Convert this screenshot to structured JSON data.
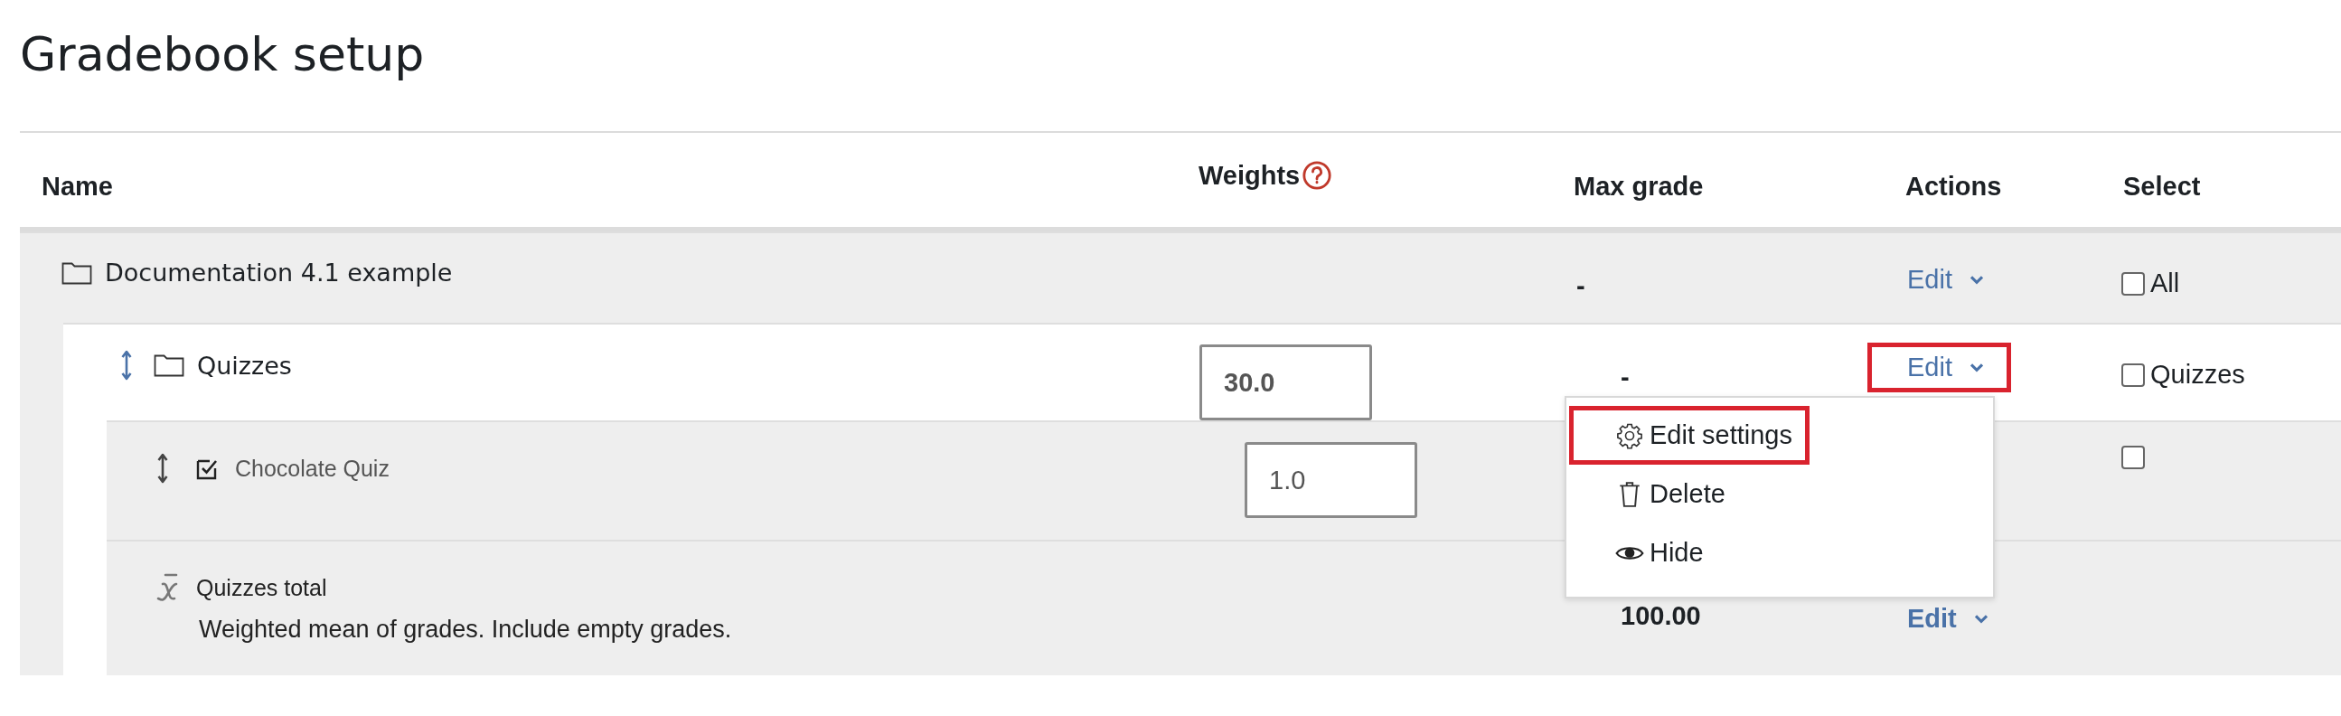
{
  "page_title": "Gradebook setup",
  "columns": [
    {
      "label": "Name"
    },
    {
      "label": "Weights",
      "help": true
    },
    {
      "label": "Max grade"
    },
    {
      "label": "Actions"
    },
    {
      "label": "Select"
    }
  ],
  "rows": [
    {
      "kind": "category",
      "name": "Documentation 4.1 example",
      "max_grade": "-",
      "action": {
        "label": "Edit",
        "highlighted": false
      },
      "select": {
        "checked": false,
        "label": "All"
      },
      "children": [
        {
          "kind": "category",
          "name": "Quizzes",
          "movable": true,
          "move_active": true,
          "weight": "30.0",
          "max_grade": "-",
          "action": {
            "label": "Edit",
            "highlighted": true,
            "menu": [
              {
                "kind": "settings",
                "label": "Edit settings",
                "highlighted": true
              },
              {
                "kind": "delete",
                "label": "Delete",
                "highlighted": false
              },
              {
                "kind": "hide",
                "label": "Hide",
                "highlighted": false
              }
            ]
          },
          "select": {
            "checked": false,
            "label": "Quizzes"
          },
          "children": [
            {
              "kind": "item",
              "name": "Chocolate Quiz",
              "movable": true,
              "move_active": false,
              "weight": "1.0",
              "select": {
                "checked": false
              }
            },
            {
              "kind": "total",
              "name": "Quizzes total",
              "description": "Weighted mean of grades. Include empty grades.",
              "max_grade": "100.00",
              "action": {
                "label": "Edit",
                "highlighted": false
              }
            }
          ]
        }
      ]
    }
  ]
}
